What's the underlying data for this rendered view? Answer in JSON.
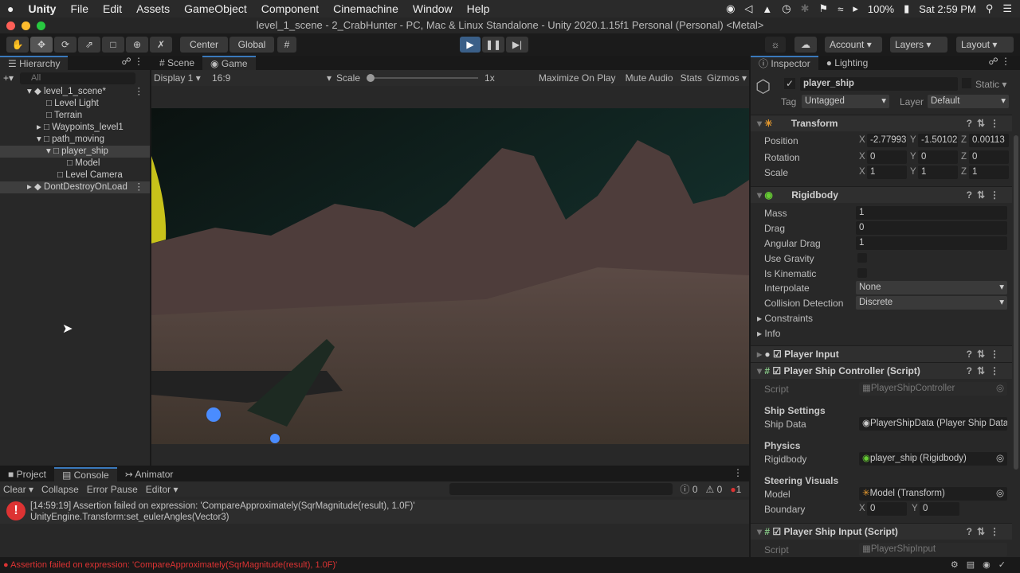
{
  "menubar": {
    "apple": "",
    "app": "Unity",
    "items": [
      "File",
      "Edit",
      "Assets",
      "GameObject",
      "Component",
      "Cinemachine",
      "Window",
      "Help"
    ],
    "battery": "100%",
    "clock": "Sat 2:59 PM"
  },
  "window": {
    "title": "level_1_scene - 2_CrabHunter - PC, Mac & Linux Standalone - Unity 2020.1.15f1 Personal (Personal) <Metal>"
  },
  "toolbar": {
    "center": "Center",
    "global": "Global",
    "account": "Account",
    "layers": "Layers",
    "layout": "Layout"
  },
  "hierarchy": {
    "tab": "Hierarchy",
    "search_placeholder": "All",
    "items": [
      {
        "label": "level_1_scene*",
        "depth": 0
      },
      {
        "label": "Level Light",
        "depth": 1
      },
      {
        "label": "Terrain",
        "depth": 1
      },
      {
        "label": "Waypoints_level1",
        "depth": 1
      },
      {
        "label": "path_moving",
        "depth": 1
      },
      {
        "label": "player_ship",
        "depth": 2
      },
      {
        "label": "Model",
        "depth": 3
      },
      {
        "label": "Level Camera",
        "depth": 2
      },
      {
        "label": "DontDestroyOnLoad",
        "depth": 0
      }
    ]
  },
  "game": {
    "tabs": [
      "Scene",
      "Game"
    ],
    "display": "Display 1",
    "aspect": "16:9",
    "scale_label": "Scale",
    "scale_value": "1x",
    "maximize": "Maximize On Play",
    "mute": "Mute Audio",
    "stats": "Stats",
    "gizmos": "Gizmos"
  },
  "inspector": {
    "tabs": [
      "Inspector",
      "Lighting"
    ],
    "object_name": "player_ship",
    "static": "Static",
    "tag_label": "Tag",
    "tag": "Untagged",
    "layer_label": "Layer",
    "layer": "Default",
    "transform": {
      "title": "Transform",
      "position_label": "Position",
      "rotation_label": "Rotation",
      "scale_label": "Scale",
      "position": [
        "-2.77993",
        "-1.50102",
        "0.00113"
      ],
      "rotation": [
        "0",
        "0",
        "0"
      ],
      "scale": [
        "1",
        "1",
        "1"
      ]
    },
    "rigidbody": {
      "title": "Rigidbody",
      "mass_label": "Mass",
      "mass": "1",
      "drag_label": "Drag",
      "drag": "0",
      "angular_label": "Angular Drag",
      "angular": "1",
      "gravity_label": "Use Gravity",
      "kinematic_label": "Is Kinematic",
      "interpolate_label": "Interpolate",
      "interpolate": "None",
      "collision_label": "Collision Detection",
      "collision": "Discrete",
      "constraints": "Constraints",
      "info": "Info"
    },
    "player_input": "Player Input",
    "controller": {
      "title": "Player Ship Controller (Script)",
      "script_label": "Script",
      "script": "PlayerShipController",
      "ship_settings": "Ship Settings",
      "ship_data_label": "Ship Data",
      "ship_data": "PlayerShipData (Player Ship Data)",
      "physics": "Physics",
      "rigidbody_label": "Rigidbody",
      "rigidbody": "player_ship (Rigidbody)",
      "steering": "Steering Visuals",
      "model_label": "Model",
      "model": "Model (Transform)",
      "boundary_label": "Boundary",
      "boundary": [
        "0",
        "0"
      ]
    },
    "ship_input": {
      "title": "Player Ship Input (Script)",
      "script_label": "Script",
      "script": "PlayerShipInput"
    }
  },
  "console": {
    "tabs": [
      "Project",
      "Console",
      "Animator"
    ],
    "clear": "Clear",
    "collapse": "Collapse",
    "error_pause": "Error Pause",
    "editor": "Editor",
    "counts": [
      "0",
      "0",
      "1"
    ],
    "message_line1": "[14:59:19] Assertion failed on expression: 'CompareApproximately(SqrMagnitude(result), 1.0F)'",
    "message_line2": "UnityEngine.Transform:set_eulerAngles(Vector3)"
  },
  "status": {
    "message": "Assertion failed on expression: 'CompareApproximately(SqrMagnitude(result), 1.0F)'"
  }
}
